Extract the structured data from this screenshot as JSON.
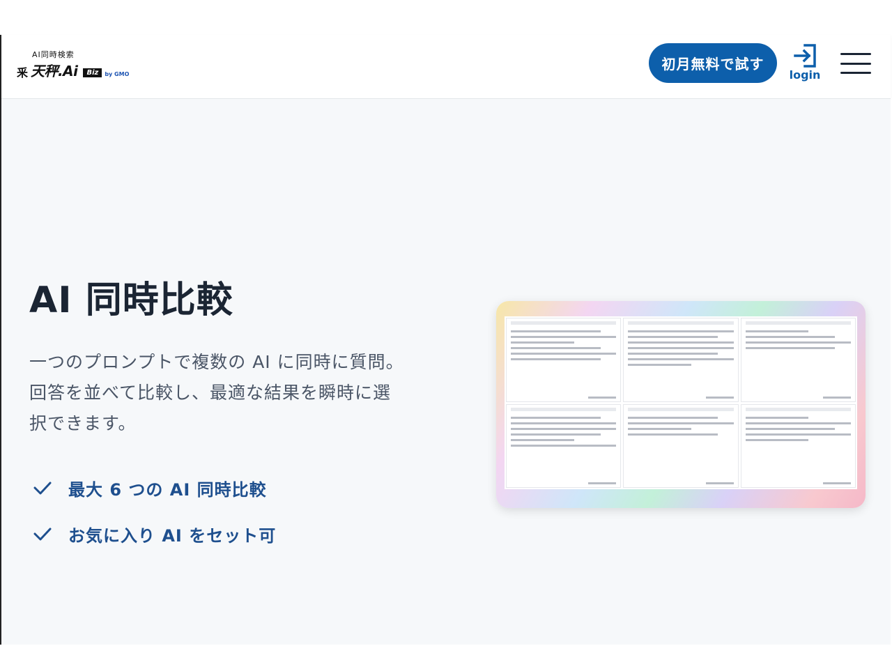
{
  "header": {
    "logo_tagline": "AI同時検索",
    "logo_mark": "⾤",
    "logo_name": "天秤.Ai",
    "logo_badge": "Biz",
    "logo_by": "by GMO",
    "cta_label": "初月無料で試す",
    "login_label": "login"
  },
  "hero": {
    "title": "AI 同時比較",
    "description": "一つのプロンプトで複数の AI に同時に質問。回答を並べて比較し、最適な結果を瞬時に選択できます。",
    "features": [
      "最大 6 つの AI 同時比較",
      "お気に入り AI をセット可"
    ]
  },
  "colors": {
    "accent": "#0d5fab",
    "title": "#1b2533",
    "feature_text": "#1e4f8e",
    "hero_bg": "#f6f8fa"
  },
  "icons": {
    "login": "login-arrow-icon",
    "menu": "hamburger-menu-icon",
    "check": "check-icon"
  }
}
